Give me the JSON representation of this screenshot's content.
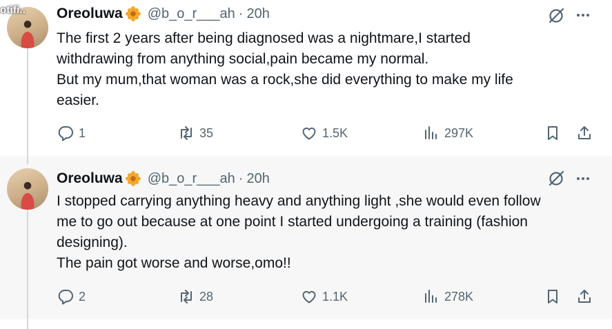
{
  "watermark": "otifi..",
  "tweets": [
    {
      "author_name": "Oreoluwa",
      "handle": "@b_o_r___ah",
      "separator": "·",
      "time": "20h",
      "lines": [
        "The first 2 years after being diagnosed was a nightmare,I started",
        "withdrawing from anything social,pain became my normal.",
        "But my mum,that woman was a rock,she did everything to make my life",
        "easier."
      ],
      "replies": "1",
      "retweets": "35",
      "likes": "1.5K",
      "views": "297K"
    },
    {
      "author_name": "Oreoluwa",
      "handle": "@b_o_r___ah",
      "separator": "·",
      "time": "20h",
      "lines": [
        "I stopped carrying anything heavy and anything light ,she would even follow",
        "me to go out because at one point I started undergoing a training (fashion",
        "designing).",
        "The pain got worse and worse,omo!!"
      ],
      "replies": "2",
      "retweets": "28",
      "likes": "1.1K",
      "views": "278K"
    }
  ],
  "icons": {
    "flower": "sunflower-emoji",
    "grok": "grok-icon",
    "more": "more-icon",
    "reply": "reply-icon",
    "retweet": "retweet-icon",
    "like": "heart-icon",
    "views": "views-icon",
    "bookmark": "bookmark-icon",
    "share": "share-icon"
  },
  "colors": {
    "text": "#0f1419",
    "secondary": "#536471",
    "thread_line": "#cfd9de",
    "flower": "#f5a623"
  }
}
